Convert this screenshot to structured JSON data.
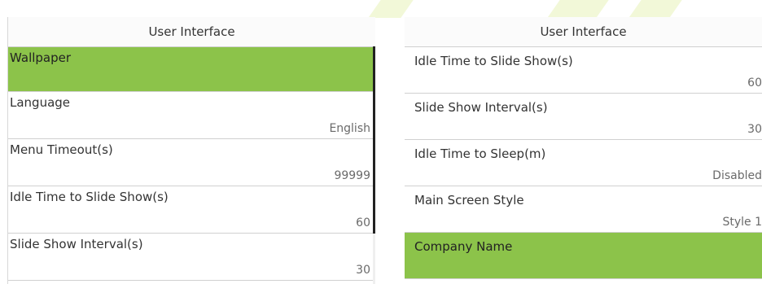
{
  "left_screen": {
    "title": "User Interface",
    "items": [
      {
        "label": "Wallpaper",
        "value": "",
        "selected": true
      },
      {
        "label": "Language",
        "value": "English",
        "selected": false
      },
      {
        "label": "Menu Timeout(s)",
        "value": "99999",
        "selected": false
      },
      {
        "label": "Idle Time to Slide Show(s)",
        "value": "60",
        "selected": false
      },
      {
        "label": "Slide Show Interval(s)",
        "value": "30",
        "selected": false
      }
    ]
  },
  "right_screen": {
    "title": "User Interface",
    "items": [
      {
        "label": "Idle Time to Slide Show(s)",
        "value": "60",
        "selected": false
      },
      {
        "label": "Slide Show Interval(s)",
        "value": "30",
        "selected": false
      },
      {
        "label": "Idle Time to Sleep(m)",
        "value": "Disabled",
        "selected": false
      },
      {
        "label": "Main Screen Style",
        "value": "Style 1",
        "selected": false
      },
      {
        "label": "Company Name",
        "value": "",
        "selected": true
      }
    ]
  },
  "colors": {
    "selected_bg": "#8cc34a",
    "divider": "#d0d0d0",
    "value_text": "#6a6a6a"
  }
}
